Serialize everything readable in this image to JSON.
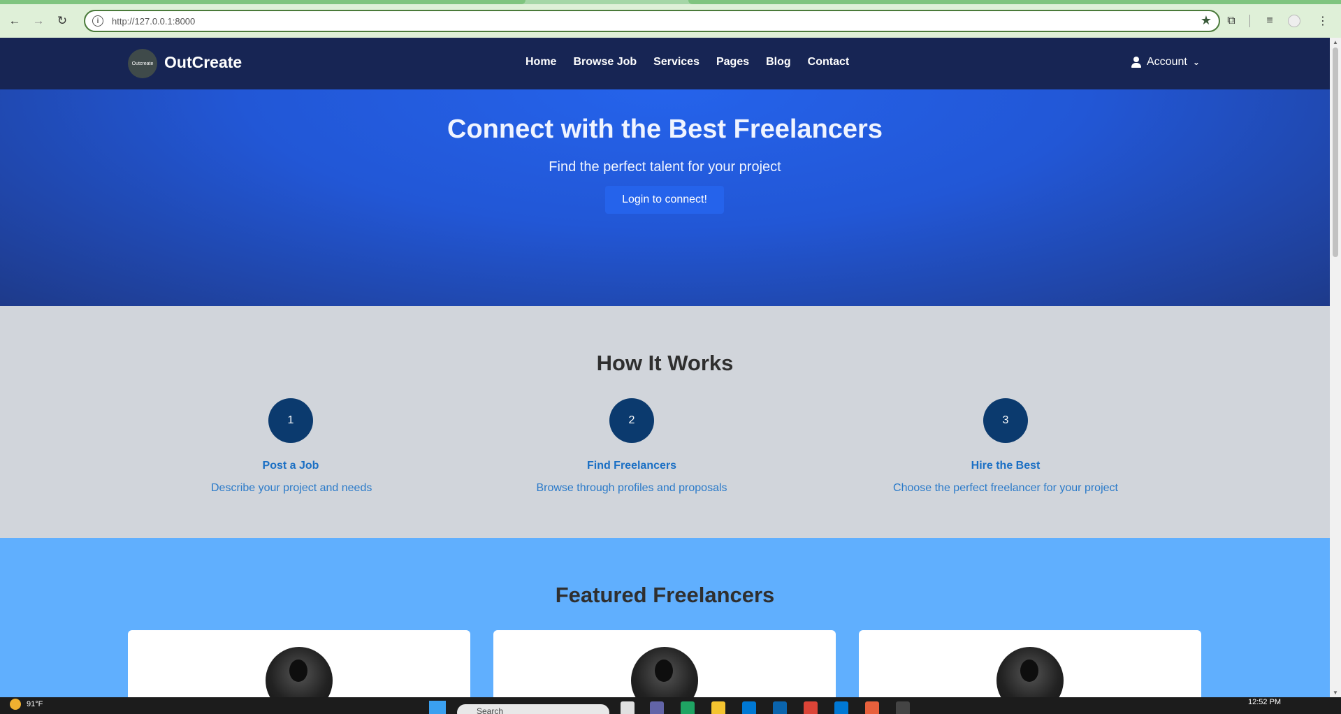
{
  "browser": {
    "url": "http://127.0.0.1:8000",
    "back_icon": "arrow-left",
    "forward_icon": "arrow-right",
    "reload_icon": "reload",
    "star_icon": "star",
    "extensions_icon": "puzzle",
    "menu_icon": "kebab"
  },
  "site": {
    "logo_text": "Outcreate",
    "brand": "OutCreate",
    "nav": [
      "Home",
      "Browse Job",
      "Services",
      "Pages",
      "Blog",
      "Contact"
    ],
    "account_label": "Account"
  },
  "hero": {
    "title": "Connect with the Best Freelancers",
    "subtitle": "Find the perfect talent for your project",
    "cta": "Login to connect!"
  },
  "how_it_works": {
    "title": "How It Works",
    "steps": [
      {
        "num": "1",
        "title": "Post a Job",
        "desc": "Describe your project and needs"
      },
      {
        "num": "2",
        "title": "Find Freelancers",
        "desc": "Browse through profiles and proposals"
      },
      {
        "num": "3",
        "title": "Hire the Best",
        "desc": "Choose the perfect freelancer for your project"
      }
    ]
  },
  "featured": {
    "title": "Featured Freelancers"
  },
  "taskbar": {
    "temperature": "91°F",
    "search_placeholder": "Search",
    "time": "12:52 PM"
  },
  "colors": {
    "navbar": "#172554",
    "hero": "#2563eb",
    "step_circle": "#0b3a6e",
    "step_text": "#1a6fc4",
    "featured_bg": "#60affe"
  }
}
